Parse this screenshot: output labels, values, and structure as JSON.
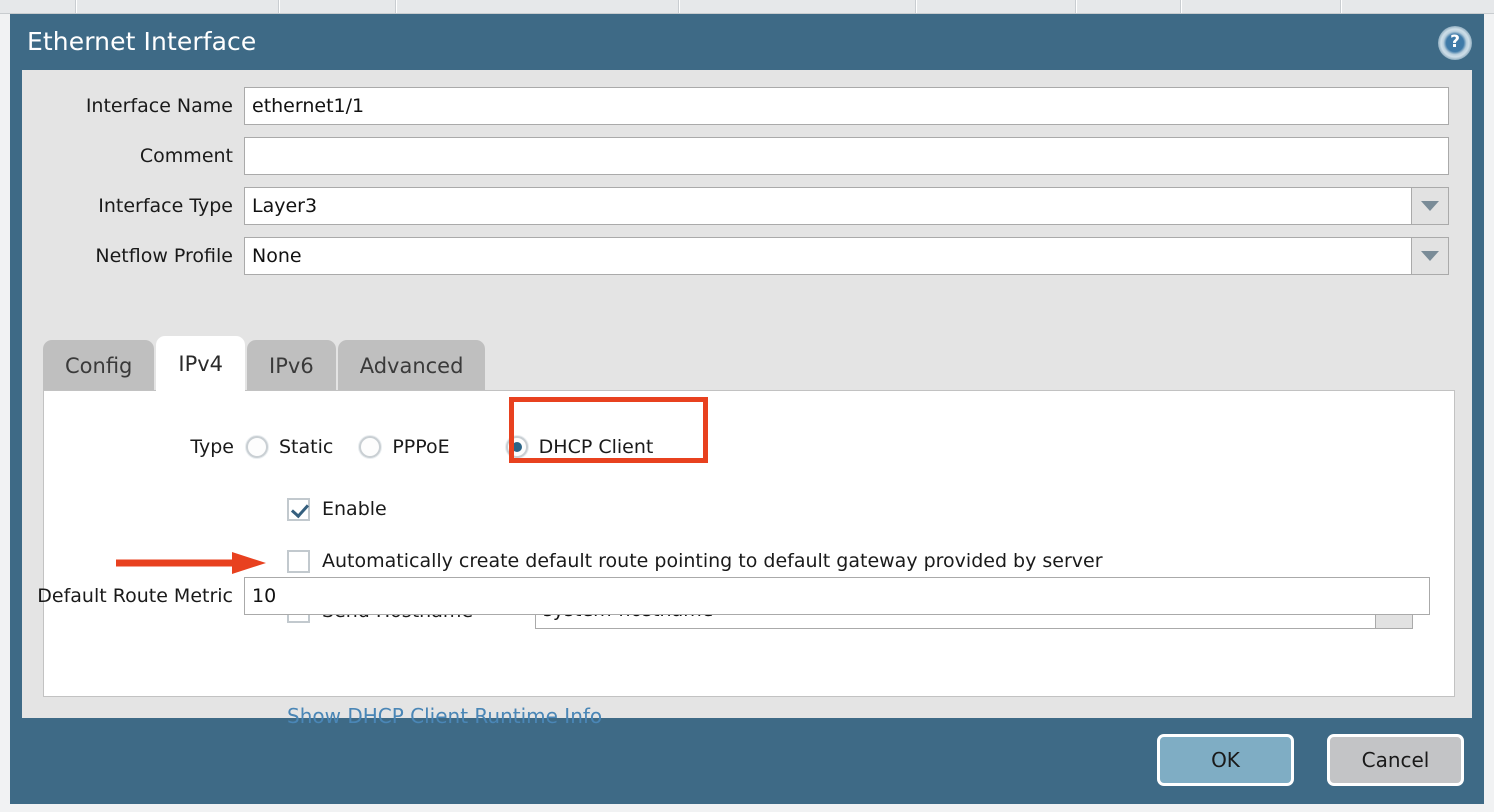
{
  "background": {
    "column_divider_positions": [
      75,
      278,
      395,
      678,
      915,
      1075,
      1180,
      1340
    ]
  },
  "modal": {
    "title": "Ethernet Interface",
    "help_icon": "help-question-icon",
    "help_glyph": "?",
    "colors": {
      "header_blue": "#3e6a86",
      "body_gray": "#e4e4e4",
      "panel_white": "#ffffff",
      "annotation_red": "#e8411f",
      "link_blue": "#4a86b6",
      "ok_button_blue": "#7fadc4",
      "cancel_button_gray": "#c3c4c6",
      "radio_selected": "#2b6487",
      "checkmark": "#355f7e"
    },
    "fields": [
      {
        "label": "Interface Name",
        "value": "ethernet1/1",
        "placeholder": "",
        "type": "text"
      },
      {
        "label": "Comment",
        "value": "",
        "placeholder": "",
        "type": "text"
      },
      {
        "label": "Interface Type",
        "value": "Layer3",
        "placeholder": "",
        "type": "combo"
      },
      {
        "label": "Netflow Profile",
        "value": "None",
        "placeholder": "",
        "type": "combo"
      }
    ],
    "tabs": [
      {
        "label": "Config",
        "active": false
      },
      {
        "label": "IPv4",
        "active": true
      },
      {
        "label": "IPv6",
        "active": false
      },
      {
        "label": "Advanced",
        "active": false
      }
    ],
    "ipv4": {
      "type_label": "Type",
      "type_options": [
        {
          "label": "Static",
          "selected": false,
          "highlighted": false
        },
        {
          "label": "PPPoE",
          "selected": false,
          "highlighted": false
        },
        {
          "label": "DHCP Client",
          "selected": true,
          "highlighted": true
        }
      ],
      "enable": {
        "label": "Enable",
        "checked": true
      },
      "auto_default_route": {
        "label": "Automatically create default route pointing to default gateway provided by server",
        "checked": false,
        "annotated_with_arrow": true
      },
      "send_hostname": {
        "label": "Send Hostname",
        "checked": false,
        "value": "system-hostname",
        "placeholder": ""
      },
      "default_route_metric": {
        "label": "Default Route Metric",
        "value": "10",
        "placeholder": ""
      },
      "runtime_link": "Show DHCP Client Runtime Info"
    },
    "footer": {
      "ok_label": "OK",
      "cancel_label": "Cancel"
    }
  }
}
